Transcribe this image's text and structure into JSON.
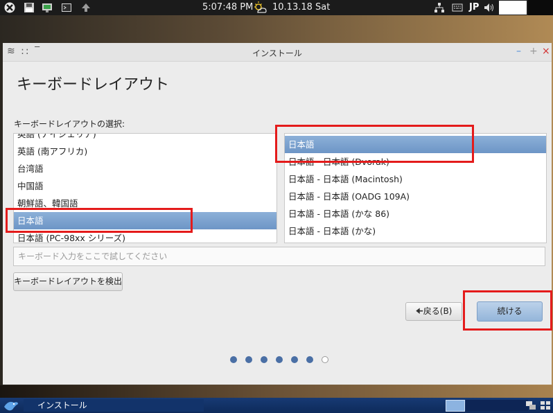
{
  "top_panel": {
    "time": "5:07:48 PM",
    "date": "10.13.18 Sat",
    "input_method": "JP",
    "icons": [
      "app-menu-icon",
      "save-icon",
      "monitor-icon",
      "terminal-icon",
      "arrow-up-icon",
      "network-icon",
      "keyboard-icon",
      "volume-icon"
    ]
  },
  "window": {
    "title": "インストール",
    "left_controls": "≋ ::  ‾",
    "page_title": "キーボードレイアウト",
    "section_label": "キーボードレイアウトの選択:",
    "layouts": [
      "英語 (ナイジェリア)",
      "英語 (南アフリカ)",
      "台湾語",
      "中国語",
      "朝鮮語、韓国語",
      "日本語",
      "日本語 (PC-98xx シリーズ)"
    ],
    "selected_layout_index": 5,
    "variants": [
      "日本語",
      "日本語 - 日本語 (Dvorak)",
      "日本語 - 日本語 (Macintosh)",
      "日本語 - 日本語 (OADG 109A)",
      "日本語 - 日本語 (かな 86)",
      "日本語 - 日本語 (かな)"
    ],
    "selected_variant_index": 0,
    "test_placeholder": "キーボード入力をここで試してください",
    "detect_button": "キーボードレイアウトを検出",
    "back_button": "戻る(B)",
    "continue_button": "続ける",
    "progress": {
      "total_steps": 7,
      "completed_steps": 6
    }
  },
  "taskbar": {
    "task_label": "インストール"
  },
  "colors": {
    "highlight": "#e41b1b",
    "selection": "#6d95c6",
    "panel": "#1b1b1b",
    "taskbar": "#173a74"
  }
}
